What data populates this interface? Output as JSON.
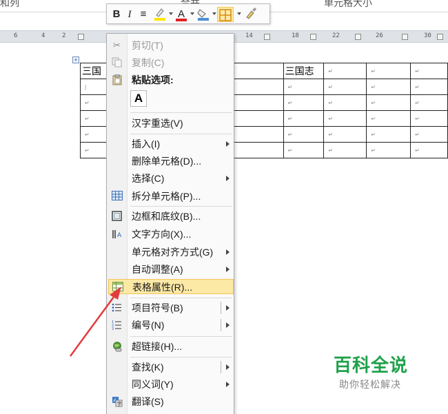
{
  "ribbon": {
    "left_label": "和列",
    "center_label": "合并",
    "right_label": "单元格大小"
  },
  "ruler": {
    "numbers": [
      "6",
      "4",
      "2",
      "14",
      "18",
      "22",
      "26",
      "30"
    ]
  },
  "mini_toolbar": {
    "bold": "B",
    "italic": "I",
    "align": "≡",
    "font_color_glyph": "A"
  },
  "table": {
    "header_cells": [
      "三国",
      "",
      "三国志",
      "",
      "三国志",
      "",
      "",
      ""
    ],
    "cell_mark": "↵",
    "rows": 5
  },
  "context_menu": {
    "cut": "剪切(T)",
    "copy": "复制(C)",
    "paste_options": "粘贴选项:",
    "paste_keep_text": "A",
    "reconvert": "汉字重选(V)",
    "insert": "插入(I)",
    "delete_cells": "删除单元格(D)...",
    "select": "选择(C)",
    "split_cells": "拆分单元格(P)...",
    "borders_shading": "边框和底纹(B)...",
    "text_direction": "文字方向(X)...",
    "cell_alignment": "单元格对齐方式(G)",
    "autofit": "自动调整(A)",
    "table_properties": "表格属性(R)...",
    "bullets": "项目符号(B)",
    "numbering": "编号(N)",
    "hyperlink": "超链接(H)...",
    "find": "查找(K)",
    "synonyms": "同义词(Y)",
    "translate": "翻译(S)"
  },
  "watermark": {
    "title": "百科全说",
    "subtitle": "助你轻松解决"
  },
  "colors": {
    "highlight": "#fde9a6",
    "highlight_border": "#f2c55c",
    "arrow": "#e23b3b",
    "watermark_green": "#1fa14a"
  }
}
